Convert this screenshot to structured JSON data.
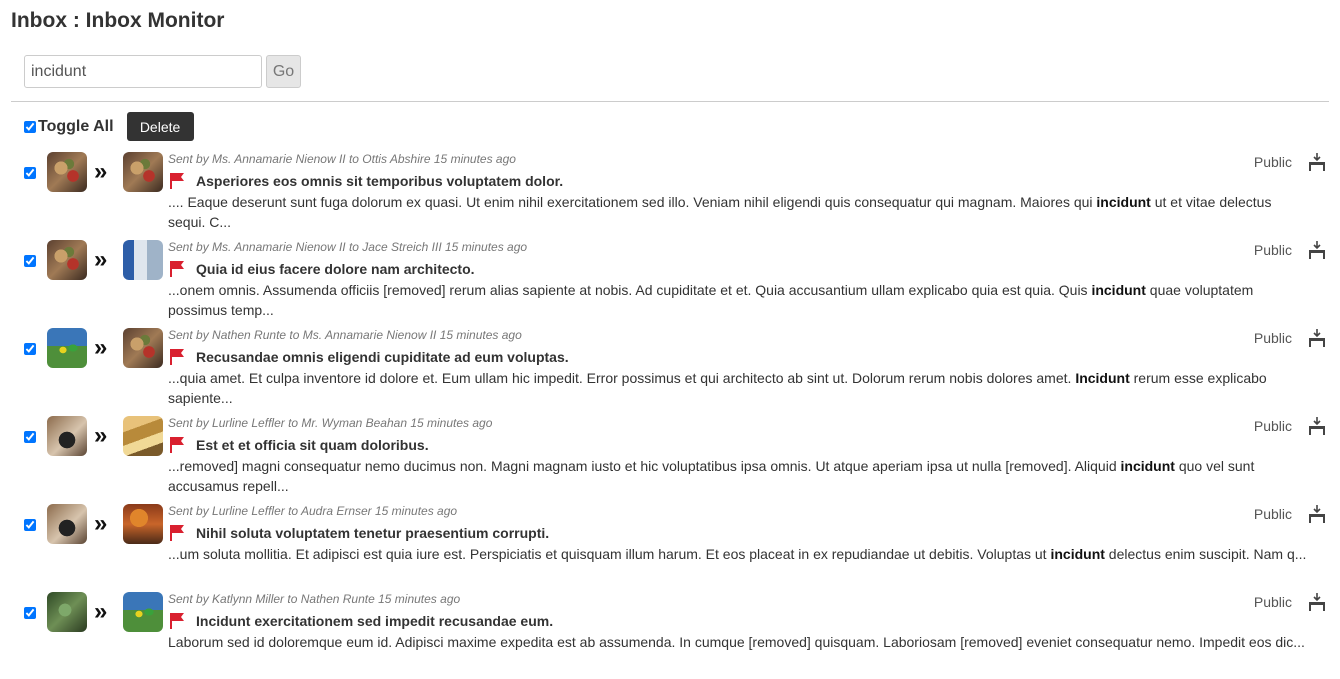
{
  "page": {
    "title": "Inbox : Inbox Monitor"
  },
  "search": {
    "value": "incidunt",
    "go_label": "Go"
  },
  "toolbar": {
    "toggle_all_label": "Toggle All",
    "delete_label": "Delete"
  },
  "colors": {
    "flag": "#d9202f",
    "delete_button": "#333333",
    "meta_text": "#777777"
  },
  "messages": [
    {
      "checked": true,
      "sender_avatar": "food-photo",
      "recipient_avatar": "food-photo",
      "meta": "Sent by Ms. Annamarie Nienow II to Ottis Abshire 15 minutes ago",
      "subject": "Asperiores eos omnis sit temporibus voluptatem dolor.",
      "snippet_before": ".... Eaque deserunt sunt fuga dolorum ex quasi. Ut enim nihil exercitationem sed illo. Veniam nihil eligendi quis consequatur qui magnam. Maiores qui ",
      "snippet_highlight": "incidunt",
      "snippet_after": " ut et vitae delectus sequi. C...",
      "visibility": "Public"
    },
    {
      "checked": true,
      "sender_avatar": "food-photo",
      "recipient_avatar": "room-photo",
      "meta": "Sent by Ms. Annamarie Nienow II to Jace Streich III 15 minutes ago",
      "subject": "Quia id eius facere dolore nam architecto.",
      "snippet_before": "...onem omnis. Assumenda officiis [removed] rerum alias sapiente at nobis. Ad cupiditate et et. Quia accusantium ullam explicabo quia est quia. Quis ",
      "snippet_highlight": "incidunt",
      "snippet_after": " quae voluptatem possimus temp...",
      "visibility": "Public"
    },
    {
      "checked": true,
      "sender_avatar": "sports-photo",
      "recipient_avatar": "food-photo",
      "meta": "Sent by Nathen Runte to Ms. Annamarie Nienow II 15 minutes ago",
      "subject": "Recusandae omnis eligendi cupiditate ad eum voluptas.",
      "snippet_before": "...quia amet. Et culpa inventore id dolore et. Eum ullam hic impedit. Error possimus et qui architecto ab sint ut. Dolorum rerum nobis dolores amet. ",
      "snippet_highlight": "Incidunt",
      "snippet_after": " rerum esse explicabo sapiente...",
      "visibility": "Public"
    },
    {
      "checked": true,
      "sender_avatar": "cafe-photo",
      "recipient_avatar": "bread-photo",
      "meta": "Sent by Lurline Leffler to Mr. Wyman Beahan 15 minutes ago",
      "subject": "Est et et officia sit quam doloribus.",
      "snippet_before": "...removed] magni consequatur nemo ducimus non. Magni magnam iusto et hic voluptatibus ipsa omnis. Ut atque aperiam ipsa ut nulla [removed]. Aliquid ",
      "snippet_highlight": "incidunt",
      "snippet_after": " quo vel sunt accusamus repell...",
      "visibility": "Public"
    },
    {
      "checked": true,
      "sender_avatar": "cafe-photo",
      "recipient_avatar": "autumn-photo",
      "meta": "Sent by Lurline Leffler to Audra Ernser 15 minutes ago",
      "subject": "Nihil soluta voluptatem tenetur praesentium corrupti.",
      "snippet_before": "...um soluta mollitia. Et adipisci est quia iure est. Perspiciatis et quisquam illum harum. Et eos placeat in ex repudiandae ut debitis. Voluptas ut ",
      "snippet_highlight": "incidunt",
      "snippet_after": " delectus enim suscipit. Nam q...",
      "visibility": "Public"
    },
    {
      "checked": true,
      "sender_avatar": "plant-photo",
      "recipient_avatar": "sports-photo",
      "meta": "Sent by Katlynn Miller to Nathen Runte 15 minutes ago",
      "subject": "Incidunt exercitationem sed impedit recusandae eum.",
      "snippet_before": "Laborum sed id doloremque eum id. Adipisci maxime expedita est ab assumenda. In cumque [removed] quisquam. Laboriosam [removed] eveniet consequatur nemo. Impedit eos dic...",
      "snippet_highlight": "",
      "snippet_after": "",
      "visibility": "Public"
    }
  ]
}
